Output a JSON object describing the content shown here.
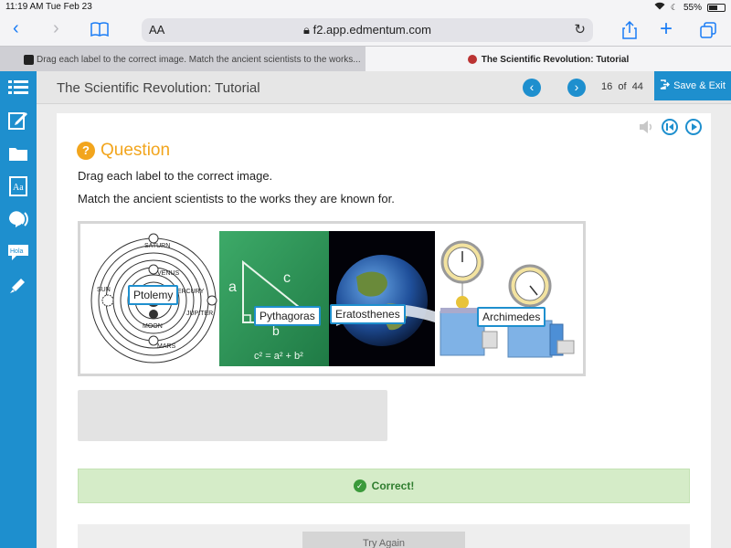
{
  "status": {
    "time": "11:19 AM",
    "date": "Tue Feb 23",
    "battery": "55%"
  },
  "browser": {
    "aa": "AA",
    "url": "f2.app.edmentum.com",
    "tabs": [
      {
        "label": "Drag each label to the correct image. Match the ancient scientists to the works..."
      },
      {
        "label": "The Scientific Revolution: Tutorial"
      }
    ]
  },
  "lesson": {
    "title": "The Scientific Revolution: Tutorial",
    "page_current": "16",
    "page_of": "of",
    "page_total": "44",
    "save_label": "Save & Exit"
  },
  "question": {
    "heading": "Question",
    "instruction1": "Drag each label to the correct image.",
    "instruction2": "Match the ancient scientists to the works they are known for.",
    "labels": [
      "Ptolemy",
      "Pythagoras",
      "Eratosthenes",
      "Archimedes"
    ],
    "feedback": "Correct!",
    "try_again": "Try Again"
  },
  "images": {
    "ptolemy_text": [
      "SATURN",
      "VENUS",
      "SUN",
      "MERCURY",
      "JUPITER",
      "MOON",
      "MARS"
    ],
    "pythagoras_text": {
      "a": "a",
      "c": "c",
      "b": "b",
      "formula": "c² = a² + b²"
    }
  },
  "colors": {
    "accent": "#1e8fce",
    "question": "#f2a51d",
    "success_bg": "#d5ecc8"
  }
}
